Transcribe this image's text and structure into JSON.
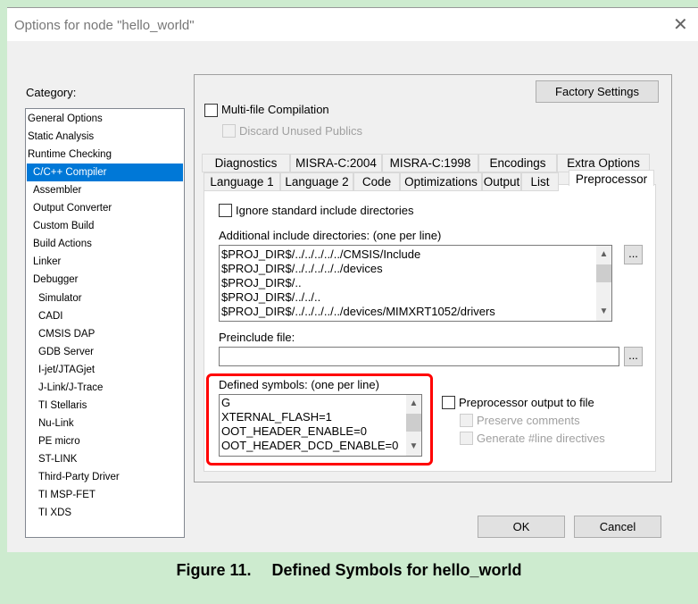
{
  "window": {
    "title": "Options for node \"hello_world\"",
    "close_glyph": "✕"
  },
  "category": {
    "label": "Category:",
    "items": [
      {
        "label": "General Options",
        "level": 0
      },
      {
        "label": "Static Analysis",
        "level": 0
      },
      {
        "label": "Runtime Checking",
        "level": 0
      },
      {
        "label": "C/C++ Compiler",
        "level": 1,
        "selected": true
      },
      {
        "label": "Assembler",
        "level": 1
      },
      {
        "label": "Output Converter",
        "level": 1
      },
      {
        "label": "Custom Build",
        "level": 1
      },
      {
        "label": "Build Actions",
        "level": 1
      },
      {
        "label": "Linker",
        "level": 1
      },
      {
        "label": "Debugger",
        "level": 1
      },
      {
        "label": "Simulator",
        "level": 2
      },
      {
        "label": "CADI",
        "level": 2
      },
      {
        "label": "CMSIS DAP",
        "level": 2
      },
      {
        "label": "GDB Server",
        "level": 2
      },
      {
        "label": "I-jet/JTAGjet",
        "level": 2
      },
      {
        "label": "J-Link/J-Trace",
        "level": 2
      },
      {
        "label": "TI Stellaris",
        "level": 2
      },
      {
        "label": "Nu-Link",
        "level": 2
      },
      {
        "label": "PE micro",
        "level": 2
      },
      {
        "label": "ST-LINK",
        "level": 2
      },
      {
        "label": "Third-Party Driver",
        "level": 2
      },
      {
        "label": "TI MSP-FET",
        "level": 2
      },
      {
        "label": "TI XDS",
        "level": 2
      }
    ]
  },
  "panel": {
    "factory_settings": "Factory Settings",
    "multi_file": "Multi-file Compilation",
    "discard_unused": "Discard Unused Publics",
    "tabs_row1": [
      "Diagnostics",
      "MISRA-C:2004",
      "MISRA-C:1998",
      "Encodings",
      "Extra Options"
    ],
    "tabs_row2": [
      "Language 1",
      "Language 2",
      "Code",
      "Optimizations",
      "Output",
      "List",
      "Preprocessor"
    ],
    "active_tab": "Preprocessor",
    "ignore_std": "Ignore standard include directories",
    "include_label": "Additional include directories: (one per line)",
    "include_dirs": [
      "$PROJ_DIR$/../../../../../CMSIS/Include",
      "$PROJ_DIR$/../../../../../devices",
      "$PROJ_DIR$/..",
      "$PROJ_DIR$/../../..",
      "$PROJ_DIR$/../../../../../devices/MIMXRT1052/drivers"
    ],
    "browse": "...",
    "preinclude_label": "Preinclude file:",
    "preinclude_value": "",
    "defined_label": "Defined symbols: (one per line)",
    "defined_symbols": [
      "G",
      "XTERNAL_FLASH=1",
      "OOT_HEADER_ENABLE=0",
      "OOT_HEADER_DCD_ENABLE=0"
    ],
    "pp_output": "Preprocessor output to file",
    "preserve_comments": "Preserve comments",
    "gen_line": "Generate #line directives"
  },
  "buttons": {
    "ok": "OK",
    "cancel": "Cancel"
  },
  "caption": "Figure 11.  Defined Symbols for hello_world",
  "colors": {
    "selection": "#0078d7",
    "highlight": "#ff0000",
    "background": "#cdebcf"
  }
}
